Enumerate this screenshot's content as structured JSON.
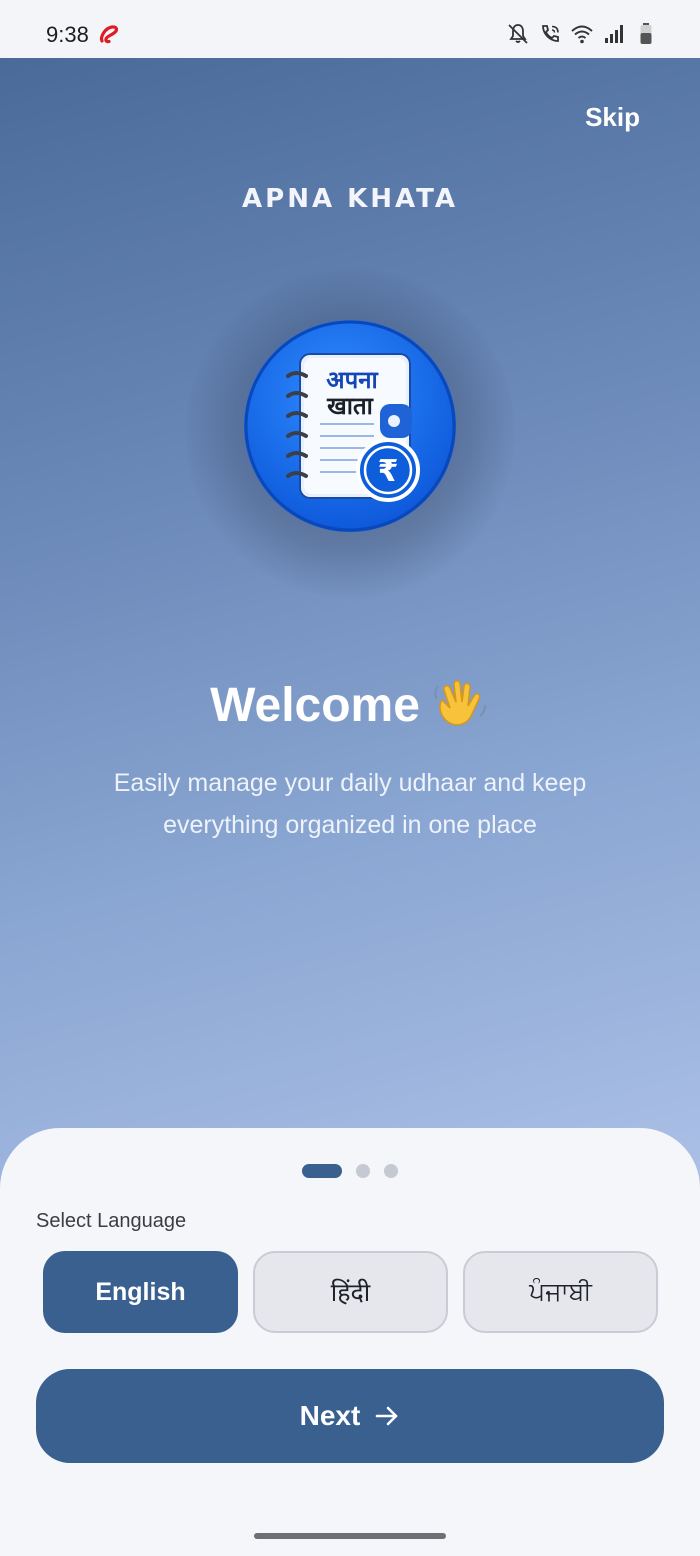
{
  "status_bar": {
    "time": "9:38",
    "icons": [
      "airtel-icon",
      "bell-off-icon",
      "wifi-call-icon",
      "wifi-icon",
      "signal-icon",
      "battery-icon"
    ]
  },
  "hero": {
    "skip_label": "Skip",
    "app_name": "APNA KHATA",
    "logo_text_line1": "अपना",
    "logo_text_line2": "खाता",
    "logo_currency": "₹",
    "welcome_title": "Welcome",
    "welcome_emoji": "waving-hand-icon",
    "subtitle": "Easily manage your daily udhaar and keep everything organized in one place"
  },
  "pager": {
    "total": 3,
    "active_index": 0
  },
  "language": {
    "label": "Select Language",
    "options": [
      {
        "label": "English",
        "selected": true
      },
      {
        "label": "हिंदी",
        "selected": false
      },
      {
        "label": "ਪੰਜਾਬੀ",
        "selected": false
      }
    ]
  },
  "next_label": "Next",
  "colors": {
    "primary": "#3a6090",
    "hero_top": "#4a6b9a",
    "hero_bottom": "#aec2e8",
    "sheet_bg": "#f5f6fa",
    "logo_blue": "#1565e0"
  }
}
